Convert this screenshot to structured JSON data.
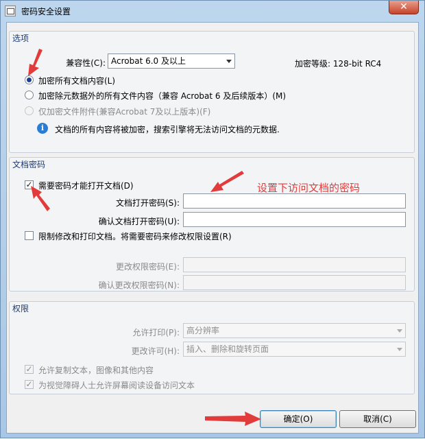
{
  "window": {
    "title": "密码安全设置",
    "close_label": "✕"
  },
  "options": {
    "group_title": "选项",
    "compat_label": "兼容性(C):",
    "compat_value": "Acrobat 6.0 及以上",
    "encrypt_level": "加密等级: 128-bit RC4",
    "radio_all": "加密所有文档内容(L)",
    "radio_except_meta": "加密除元数据外的所有文件内容（兼容 Acrobat 6 及后续版本）(M)",
    "radio_attachments": "仅加密文件附件(兼容Acrobat 7及以上版本)(F)",
    "info_text": "文档的所有内容将被加密，搜索引擎将无法访问文档的元数据."
  },
  "docpass": {
    "group_title": "文档密码",
    "require_open": "需要密码才能打开文档(D)",
    "open_pw_label": "文档打开密码(S):",
    "confirm_open_pw_label": "确认文档打开密码(U):",
    "restrict_label": "限制修改和打印文档。将需要密码来修改权限设置(R)",
    "perm_pw_label": "更改权限密码(E):",
    "confirm_perm_pw_label": "确认更改权限密码(N):"
  },
  "permissions": {
    "group_title": "权限",
    "print_label": "允许打印(P):",
    "print_value": "高分辨率",
    "change_label": "更改许可(H):",
    "change_value": "插入、删除和旋转页面",
    "copy_label": "允许复制文本，图像和其他内容",
    "screen_reader_label": "为视觉障碍人士允许屏幕阅读设备访问文本"
  },
  "buttons": {
    "ok": "确定(O)",
    "cancel": "取消(C)"
  },
  "annotation": {
    "text": "设置下访问文档的密码",
    "color": "#e23b3b"
  },
  "colors": {
    "accent": "#1d3f8a",
    "group_title": "#1e3a6e"
  }
}
